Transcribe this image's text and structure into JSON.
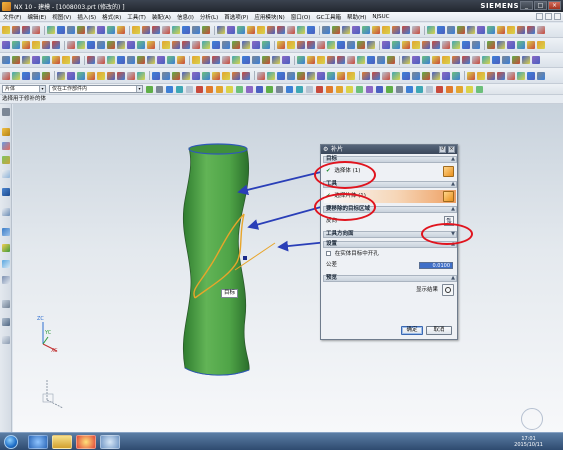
{
  "window": {
    "title": "NX 10 - 建模 - [1008003.prt (修改的) ]",
    "brand": "SIEMENS",
    "buttons": [
      "_",
      "□",
      "×"
    ]
  },
  "menubar": {
    "items": [
      "文件(F)",
      "编辑(E)",
      "视图(V)",
      "插入(S)",
      "格式(R)",
      "工具(T)",
      "装配(A)",
      "信息(I)",
      "分析(L)",
      "首选项(P)",
      "应用模块(N)",
      "窗口(O)",
      "GC工具箱",
      "帮助(H)",
      "NJSUC"
    ]
  },
  "selection_bar": {
    "filter_value": "片体",
    "scope_value": "仅在工作部件内"
  },
  "cue_line": "选择用于修补的体",
  "labels": {
    "model_tag": "目标"
  },
  "axes": {
    "x": "XC",
    "y": "YC",
    "z": "ZC"
  },
  "dialog": {
    "title": "补片",
    "sections": {
      "target": {
        "header": "目标",
        "row_label": "选择体 (1)"
      },
      "tool": {
        "header": "工具",
        "row_label": "选择片体 (1)"
      },
      "direction": {
        "header": "要移除的目标区域",
        "row_label": "反向"
      },
      "tool_direction": {
        "header": "工具方向面"
      },
      "settings": {
        "header": "设置",
        "checkbox_label": "在实体目标中开孔",
        "tolerance_label": "公差",
        "tolerance_value": "0.0100"
      },
      "preview": {
        "header": "预览",
        "show_result_label": "显示结果"
      }
    },
    "ok_label": "确定",
    "cancel_label": "取消"
  },
  "taskbar": {
    "time": "17:01",
    "date": "2015/10/11"
  },
  "colors": {
    "model_green": "#4fa447",
    "annotation_red": "#e0141e",
    "arrow_blue": "#2a3fb8",
    "edge_orange": "#e8a52a"
  }
}
